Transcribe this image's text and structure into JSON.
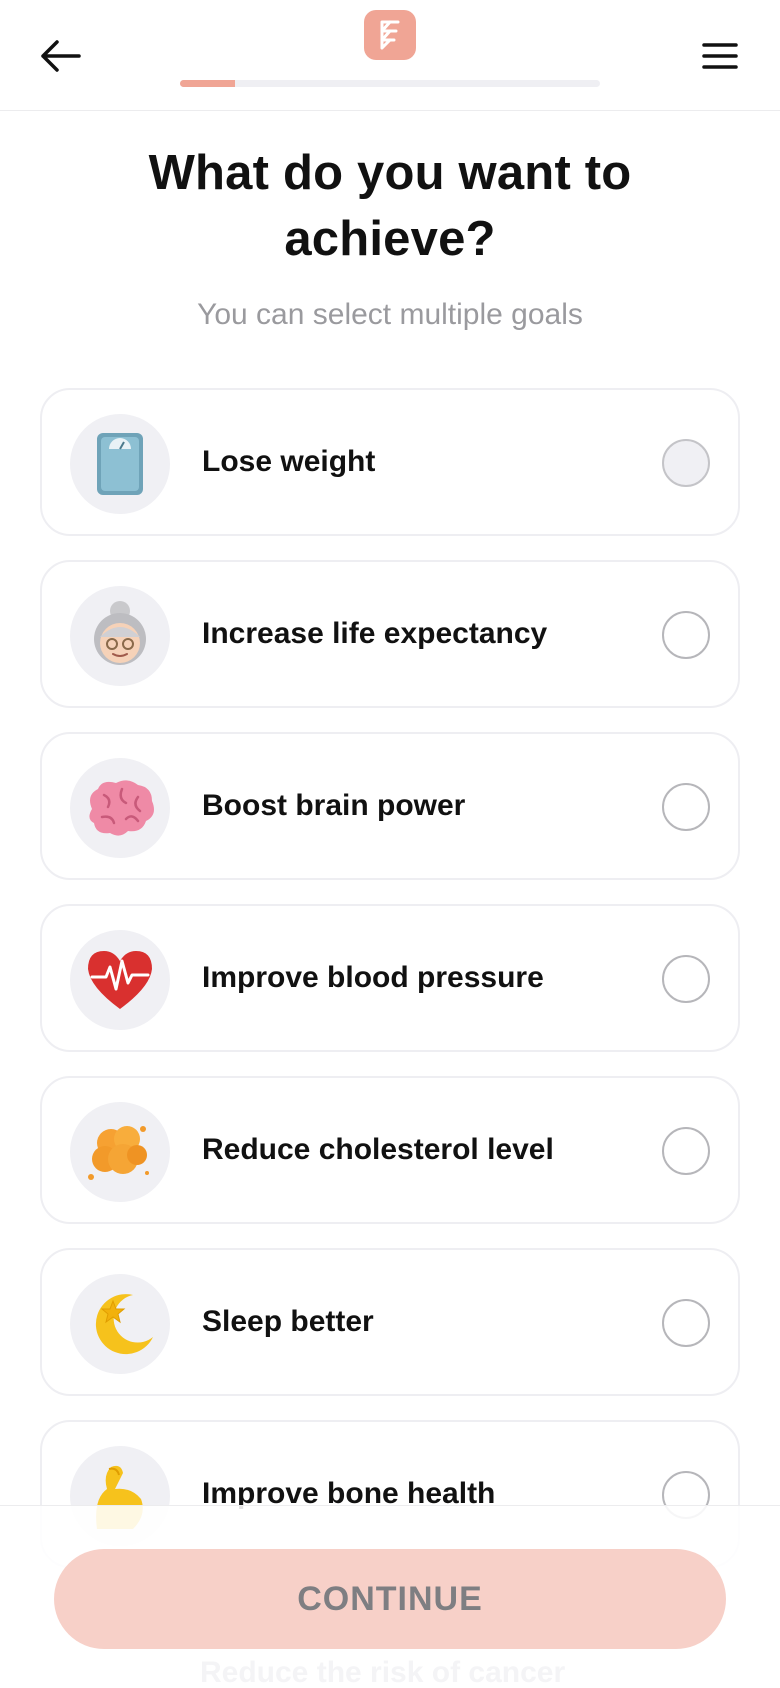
{
  "header": {
    "back_icon": "arrow-left-icon",
    "menu_icon": "hamburger-menu-icon",
    "logo_icon": "brand-logo-icon",
    "progress_fraction": 0.13,
    "accent_color": "#f0a595"
  },
  "main": {
    "title": "What do you want to achieve?",
    "subtitle": "You can select multiple goals"
  },
  "goals": [
    {
      "label": "Lose weight",
      "icon": "scale-icon",
      "radio": "filled"
    },
    {
      "label": "Increase life expectancy",
      "icon": "old-woman-icon",
      "radio": "empty"
    },
    {
      "label": "Boost brain power",
      "icon": "brain-icon",
      "radio": "empty"
    },
    {
      "label": "Improve blood pressure",
      "icon": "heart-pulse-icon",
      "radio": "empty"
    },
    {
      "label": "Reduce cholesterol level",
      "icon": "cholesterol-blob-icon",
      "radio": "empty"
    },
    {
      "label": "Sleep better",
      "icon": "moon-star-icon",
      "radio": "empty"
    },
    {
      "label": "Improve bone health",
      "icon": "flexed-arm-icon",
      "radio": "empty"
    }
  ],
  "footer": {
    "continue_label": "CONTINUE",
    "next_goal_label": "Reduce the risk of cancer"
  }
}
